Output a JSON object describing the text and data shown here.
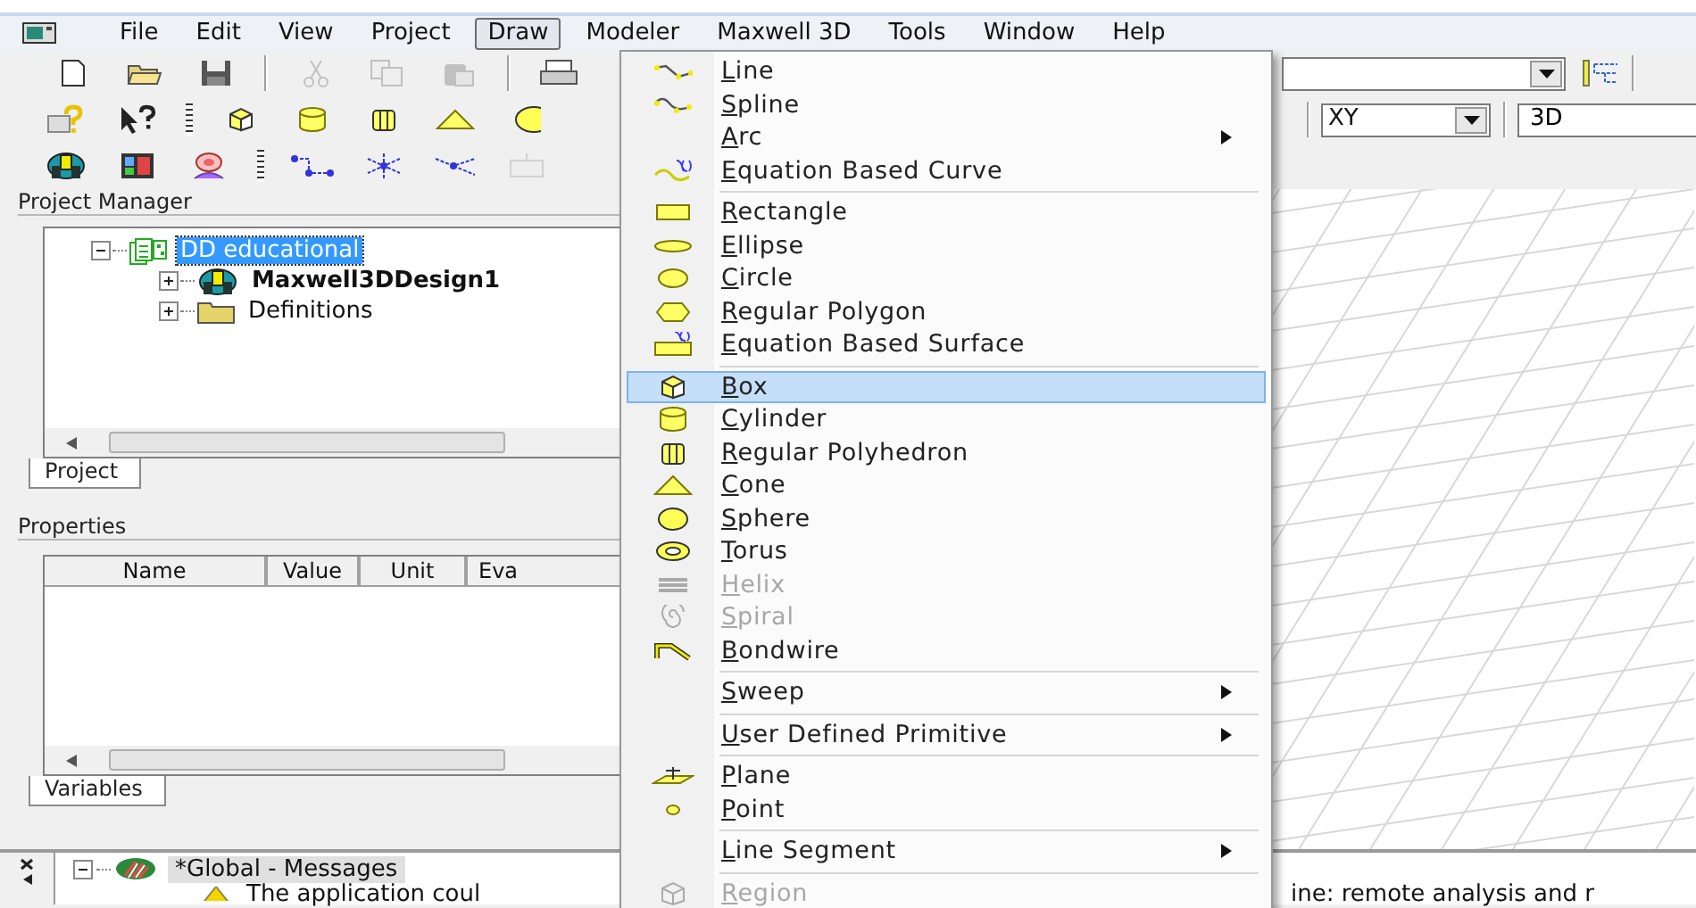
{
  "menubar": [
    {
      "label": "File",
      "selected": false
    },
    {
      "label": "Edit",
      "selected": false
    },
    {
      "label": "View",
      "selected": false
    },
    {
      "label": "Project",
      "selected": false
    },
    {
      "label": "Draw",
      "selected": true
    },
    {
      "label": "Modeler",
      "selected": false
    },
    {
      "label": "Maxwell 3D",
      "selected": false
    },
    {
      "label": "Tools",
      "selected": false
    },
    {
      "label": "Window",
      "selected": false
    },
    {
      "label": "Help",
      "selected": false
    }
  ],
  "toolbars": [
    [
      {
        "disabled": false
      },
      {
        "disabled": false
      },
      {
        "disabled": false
      },
      {
        "disabled": true
      },
      {
        "disabled": true
      },
      {
        "disabled": true
      },
      {
        "disabled": false
      }
    ],
    [
      {
        "disabled": false
      },
      {
        "disabled": false
      },
      {
        "disabled": false
      },
      {
        "disabled": false
      },
      {
        "disabled": false
      },
      {
        "disabled": false
      },
      {
        "disabled": false
      }
    ],
    [
      {
        "disabled": false
      },
      {
        "disabled": false
      },
      {
        "disabled": false
      },
      {
        "disabled": false
      },
      {
        "disabled": false
      },
      {
        "disabled": false
      },
      {
        "disabled": true
      }
    ]
  ],
  "plane_combo": {
    "value": "XY"
  },
  "view_field": {
    "value": "3D"
  },
  "project_manager": {
    "title": "Project Manager",
    "tree": [
      {
        "label": "DD educational",
        "selected": true,
        "expanded": true,
        "active": false,
        "children": [
          {
            "label": "Maxwell3DDesign1",
            "selected": false,
            "expanded": false,
            "active": true
          },
          {
            "label": "Definitions",
            "selected": false,
            "expanded": false,
            "active": false
          }
        ]
      }
    ],
    "tabs": [
      {
        "label": "Project",
        "selected": true
      }
    ]
  },
  "properties": {
    "title": "Properties",
    "columns": [
      "Name",
      "Value",
      "Unit",
      "Eva"
    ],
    "tabs": [
      {
        "label": "Variables",
        "selected": true
      }
    ]
  },
  "messages": {
    "tree": [
      {
        "label": "*Global - Messages",
        "selected": true,
        "expanded": true
      }
    ],
    "lines": [
      "The application coul",
      "ine: remote analysis and r"
    ]
  },
  "draw_menu": [
    {
      "kind": "item",
      "label": "Line",
      "selected": false,
      "disabled": false,
      "submenu": false
    },
    {
      "kind": "item",
      "label": "Spline",
      "selected": false,
      "disabled": false,
      "submenu": false
    },
    {
      "kind": "item",
      "label": "Arc",
      "selected": false,
      "disabled": false,
      "submenu": true
    },
    {
      "kind": "item",
      "label": "Equation Based Curve",
      "selected": false,
      "disabled": false,
      "submenu": false
    },
    {
      "kind": "separator"
    },
    {
      "kind": "item",
      "label": "Rectangle",
      "selected": false,
      "disabled": false,
      "submenu": false
    },
    {
      "kind": "item",
      "label": "Ellipse",
      "selected": false,
      "disabled": false,
      "submenu": false
    },
    {
      "kind": "item",
      "label": "Circle",
      "selected": false,
      "disabled": false,
      "submenu": false
    },
    {
      "kind": "item",
      "label": "Regular Polygon",
      "selected": false,
      "disabled": false,
      "submenu": false
    },
    {
      "kind": "item",
      "label": "Equation Based Surface",
      "selected": false,
      "disabled": false,
      "submenu": false
    },
    {
      "kind": "separator"
    },
    {
      "kind": "item",
      "label": "Box",
      "selected": true,
      "disabled": false,
      "submenu": false
    },
    {
      "kind": "item",
      "label": "Cylinder",
      "selected": false,
      "disabled": false,
      "submenu": false
    },
    {
      "kind": "item",
      "label": "Regular Polyhedron",
      "selected": false,
      "disabled": false,
      "submenu": false
    },
    {
      "kind": "item",
      "label": "Cone",
      "selected": false,
      "disabled": false,
      "submenu": false
    },
    {
      "kind": "item",
      "label": "Sphere",
      "selected": false,
      "disabled": false,
      "submenu": false
    },
    {
      "kind": "item",
      "label": "Torus",
      "selected": false,
      "disabled": false,
      "submenu": false
    },
    {
      "kind": "item",
      "label": "Helix",
      "selected": false,
      "disabled": true,
      "submenu": false
    },
    {
      "kind": "item",
      "label": "Spiral",
      "selected": false,
      "disabled": true,
      "submenu": false
    },
    {
      "kind": "item",
      "label": "Bondwire",
      "selected": false,
      "disabled": false,
      "submenu": false
    },
    {
      "kind": "separator"
    },
    {
      "kind": "item",
      "label": "Sweep",
      "selected": false,
      "disabled": false,
      "submenu": true
    },
    {
      "kind": "separator"
    },
    {
      "kind": "item",
      "label": "User Defined Primitive",
      "selected": false,
      "disabled": false,
      "submenu": true
    },
    {
      "kind": "separator"
    },
    {
      "kind": "item",
      "label": "Plane",
      "selected": false,
      "disabled": false,
      "submenu": false
    },
    {
      "kind": "item",
      "label": "Point",
      "selected": false,
      "disabled": false,
      "submenu": false
    },
    {
      "kind": "separator"
    },
    {
      "kind": "item",
      "label": "Line Segment",
      "selected": false,
      "disabled": false,
      "submenu": true
    },
    {
      "kind": "separator"
    },
    {
      "kind": "item",
      "label": "Region",
      "selected": false,
      "disabled": true,
      "submenu": false
    }
  ]
}
